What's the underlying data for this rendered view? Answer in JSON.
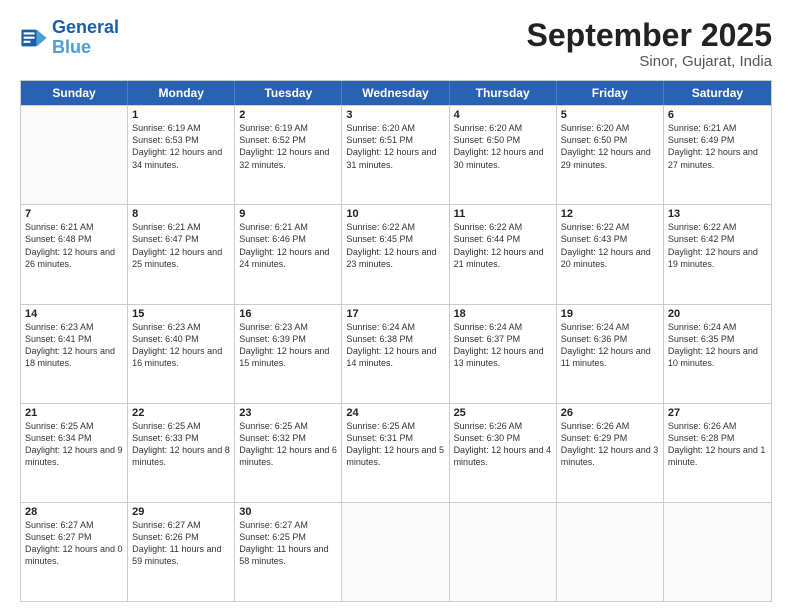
{
  "logo": {
    "line1": "General",
    "line2": "Blue"
  },
  "title": "September 2025",
  "subtitle": "Sinor, Gujarat, India",
  "days": [
    "Sunday",
    "Monday",
    "Tuesday",
    "Wednesday",
    "Thursday",
    "Friday",
    "Saturday"
  ],
  "weeks": [
    [
      {
        "num": "",
        "empty": true
      },
      {
        "num": "1",
        "sunrise": "6:19 AM",
        "sunset": "6:53 PM",
        "daylight": "12 hours and 34 minutes."
      },
      {
        "num": "2",
        "sunrise": "6:19 AM",
        "sunset": "6:52 PM",
        "daylight": "12 hours and 32 minutes."
      },
      {
        "num": "3",
        "sunrise": "6:20 AM",
        "sunset": "6:51 PM",
        "daylight": "12 hours and 31 minutes."
      },
      {
        "num": "4",
        "sunrise": "6:20 AM",
        "sunset": "6:50 PM",
        "daylight": "12 hours and 30 minutes."
      },
      {
        "num": "5",
        "sunrise": "6:20 AM",
        "sunset": "6:50 PM",
        "daylight": "12 hours and 29 minutes."
      },
      {
        "num": "6",
        "sunrise": "6:21 AM",
        "sunset": "6:49 PM",
        "daylight": "12 hours and 27 minutes."
      }
    ],
    [
      {
        "num": "7",
        "sunrise": "6:21 AM",
        "sunset": "6:48 PM",
        "daylight": "12 hours and 26 minutes."
      },
      {
        "num": "8",
        "sunrise": "6:21 AM",
        "sunset": "6:47 PM",
        "daylight": "12 hours and 25 minutes."
      },
      {
        "num": "9",
        "sunrise": "6:21 AM",
        "sunset": "6:46 PM",
        "daylight": "12 hours and 24 minutes."
      },
      {
        "num": "10",
        "sunrise": "6:22 AM",
        "sunset": "6:45 PM",
        "daylight": "12 hours and 23 minutes."
      },
      {
        "num": "11",
        "sunrise": "6:22 AM",
        "sunset": "6:44 PM",
        "daylight": "12 hours and 21 minutes."
      },
      {
        "num": "12",
        "sunrise": "6:22 AM",
        "sunset": "6:43 PM",
        "daylight": "12 hours and 20 minutes."
      },
      {
        "num": "13",
        "sunrise": "6:22 AM",
        "sunset": "6:42 PM",
        "daylight": "12 hours and 19 minutes."
      }
    ],
    [
      {
        "num": "14",
        "sunrise": "6:23 AM",
        "sunset": "6:41 PM",
        "daylight": "12 hours and 18 minutes."
      },
      {
        "num": "15",
        "sunrise": "6:23 AM",
        "sunset": "6:40 PM",
        "daylight": "12 hours and 16 minutes."
      },
      {
        "num": "16",
        "sunrise": "6:23 AM",
        "sunset": "6:39 PM",
        "daylight": "12 hours and 15 minutes."
      },
      {
        "num": "17",
        "sunrise": "6:24 AM",
        "sunset": "6:38 PM",
        "daylight": "12 hours and 14 minutes."
      },
      {
        "num": "18",
        "sunrise": "6:24 AM",
        "sunset": "6:37 PM",
        "daylight": "12 hours and 13 minutes."
      },
      {
        "num": "19",
        "sunrise": "6:24 AM",
        "sunset": "6:36 PM",
        "daylight": "12 hours and 11 minutes."
      },
      {
        "num": "20",
        "sunrise": "6:24 AM",
        "sunset": "6:35 PM",
        "daylight": "12 hours and 10 minutes."
      }
    ],
    [
      {
        "num": "21",
        "sunrise": "6:25 AM",
        "sunset": "6:34 PM",
        "daylight": "12 hours and 9 minutes."
      },
      {
        "num": "22",
        "sunrise": "6:25 AM",
        "sunset": "6:33 PM",
        "daylight": "12 hours and 8 minutes."
      },
      {
        "num": "23",
        "sunrise": "6:25 AM",
        "sunset": "6:32 PM",
        "daylight": "12 hours and 6 minutes."
      },
      {
        "num": "24",
        "sunrise": "6:25 AM",
        "sunset": "6:31 PM",
        "daylight": "12 hours and 5 minutes."
      },
      {
        "num": "25",
        "sunrise": "6:26 AM",
        "sunset": "6:30 PM",
        "daylight": "12 hours and 4 minutes."
      },
      {
        "num": "26",
        "sunrise": "6:26 AM",
        "sunset": "6:29 PM",
        "daylight": "12 hours and 3 minutes."
      },
      {
        "num": "27",
        "sunrise": "6:26 AM",
        "sunset": "6:28 PM",
        "daylight": "12 hours and 1 minute."
      }
    ],
    [
      {
        "num": "28",
        "sunrise": "6:27 AM",
        "sunset": "6:27 PM",
        "daylight": "12 hours and 0 minutes."
      },
      {
        "num": "29",
        "sunrise": "6:27 AM",
        "sunset": "6:26 PM",
        "daylight": "11 hours and 59 minutes."
      },
      {
        "num": "30",
        "sunrise": "6:27 AM",
        "sunset": "6:25 PM",
        "daylight": "11 hours and 58 minutes."
      },
      {
        "num": "",
        "empty": true
      },
      {
        "num": "",
        "empty": true
      },
      {
        "num": "",
        "empty": true
      },
      {
        "num": "",
        "empty": true
      }
    ]
  ]
}
